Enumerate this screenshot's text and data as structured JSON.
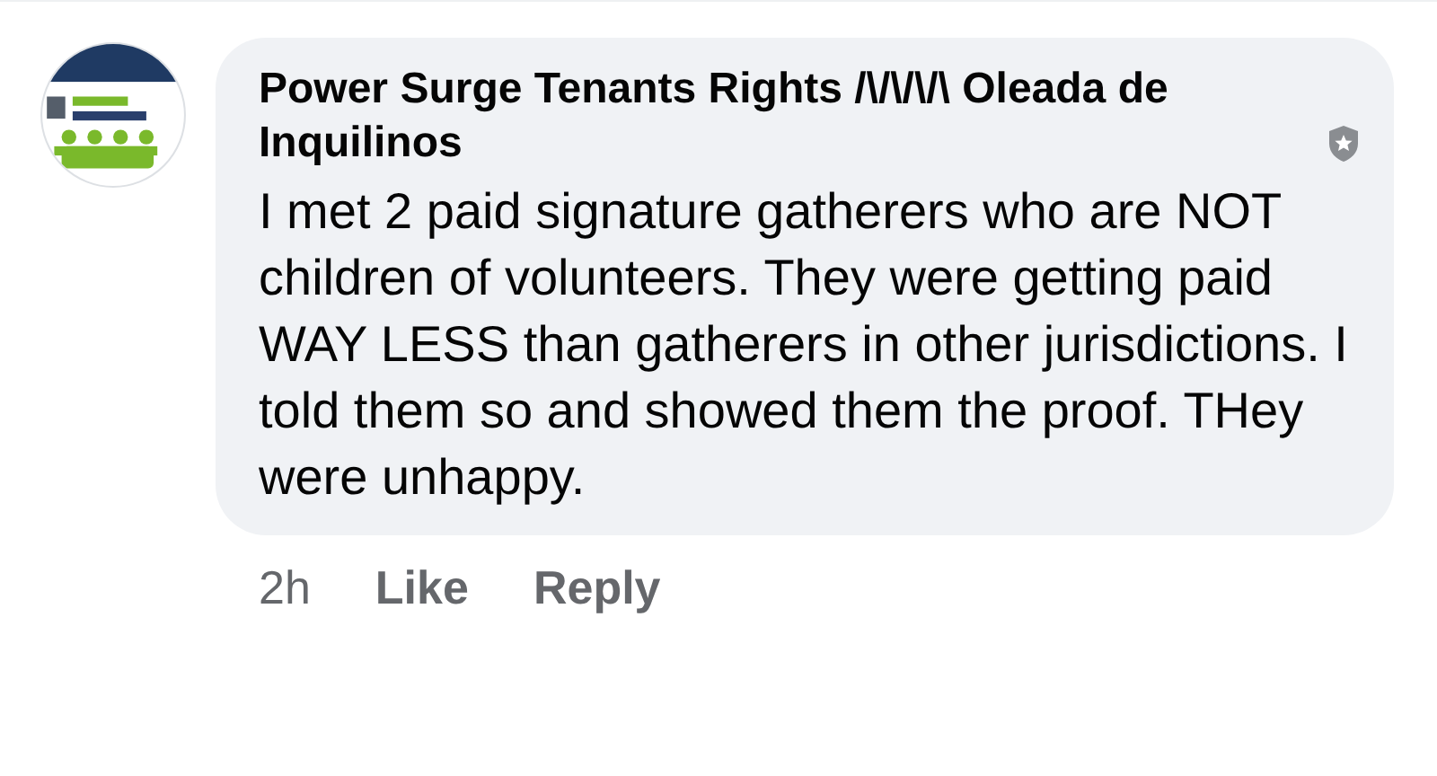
{
  "comment": {
    "author": "Power Surge Tenants Rights /\\/\\/\\/\\ Oleada de Inquilinos",
    "text": "I met 2 paid signature gatherers who are NOT children of volunteers. They were getting paid WAY LESS than gatherers in other jurisdictions. I told them so and showed them the proof. THey were unhappy.",
    "time": "2h",
    "actions": [
      "Like",
      "Reply"
    ]
  }
}
